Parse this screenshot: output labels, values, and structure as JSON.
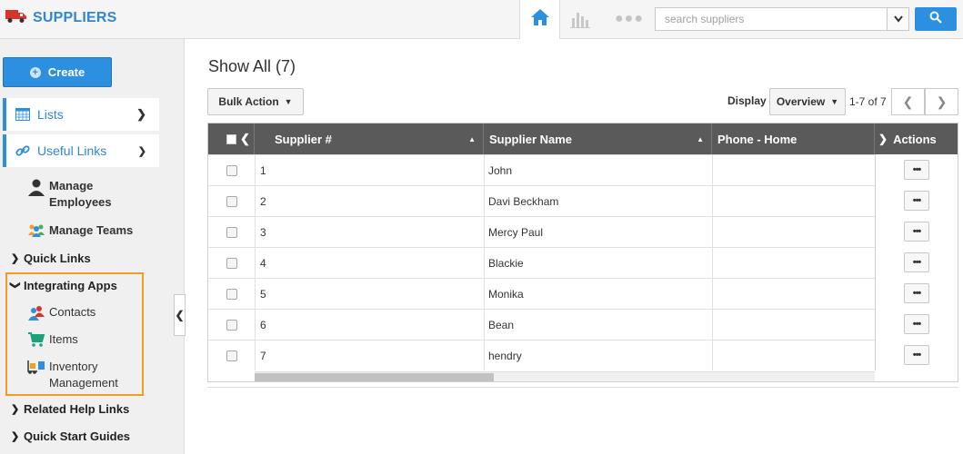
{
  "app": {
    "title": "SUPPLIERS"
  },
  "search": {
    "placeholder": "search suppliers",
    "value": ""
  },
  "sidebar": {
    "create_label": "Create",
    "lists_label": "Lists",
    "useful_links_label": "Useful Links",
    "manage_employees": [
      "Manage",
      "Employees"
    ],
    "manage_teams": "Manage Teams",
    "quick_links": "Quick Links",
    "integrating_apps": "Integrating Apps",
    "contacts": "Contacts",
    "items": "Items",
    "inventory": [
      "Inventory",
      "Management"
    ],
    "related_help": "Related Help Links",
    "quick_start": "Quick Start Guides"
  },
  "main": {
    "title": "Show All (7)",
    "bulk_action": "Bulk Action",
    "display_label": "Display",
    "display_value": "Overview",
    "pager": "1-7 of 7"
  },
  "grid": {
    "columns": [
      "Supplier #",
      "Supplier Name",
      "Phone - Home",
      "Actions"
    ],
    "rows": [
      {
        "num": "1",
        "name": "John",
        "phone": ""
      },
      {
        "num": "2",
        "name": "Davi Beckham",
        "phone": ""
      },
      {
        "num": "3",
        "name": "Mercy Paul",
        "phone": ""
      },
      {
        "num": "4",
        "name": "Blackie",
        "phone": ""
      },
      {
        "num": "5",
        "name": "Monika",
        "phone": ""
      },
      {
        "num": "6",
        "name": "Bean",
        "phone": ""
      },
      {
        "num": "7",
        "name": "hendry",
        "phone": ""
      }
    ],
    "row_action": "•••"
  },
  "colors": {
    "accent": "#2d8fe0",
    "highlight": "#f39c21",
    "header": "#5a5a5a"
  }
}
